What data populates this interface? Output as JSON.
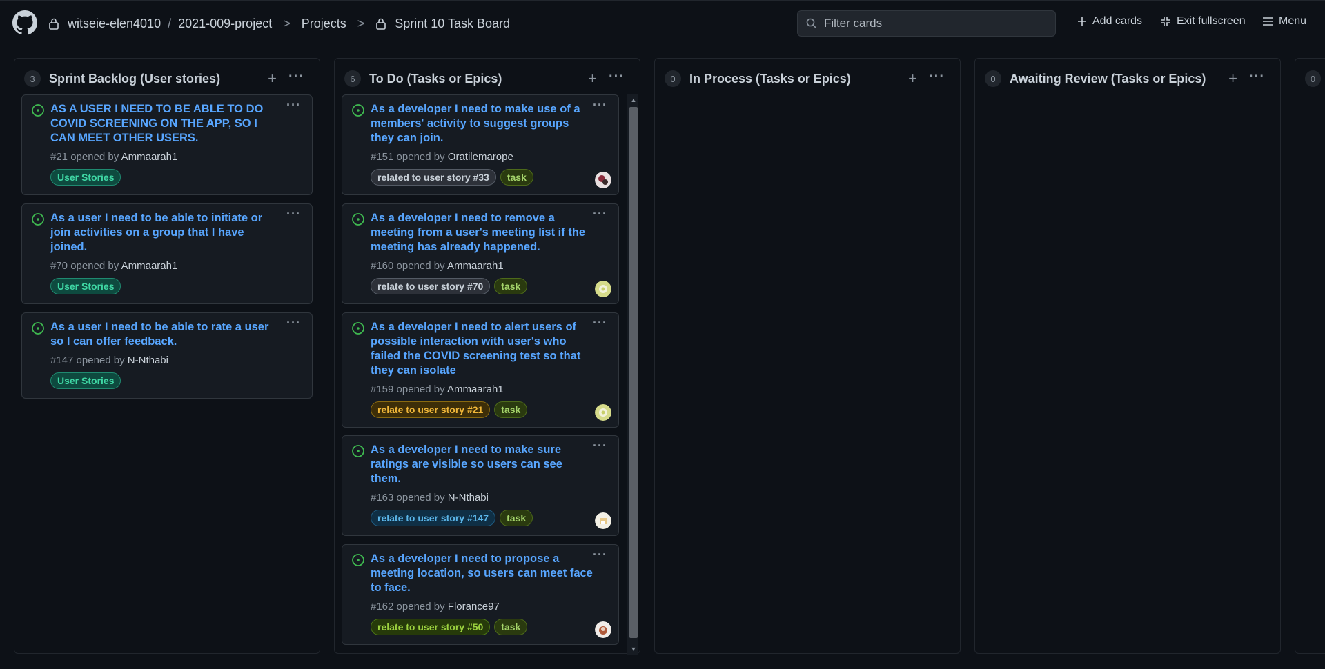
{
  "header": {
    "owner": "witseie-elen4010",
    "separator": "/",
    "repo": "2021-009-project",
    "projects": "Projects",
    "board": "Sprint 10 Task Board",
    "filter_placeholder": "Filter cards",
    "add_cards": "Add cards",
    "exit_fullscreen": "Exit fullscreen",
    "menu": "Menu"
  },
  "columns": [
    {
      "count": "3",
      "title": "Sprint Backlog (User stories)",
      "cards": [
        {
          "title": "AS A USER I NEED TO BE ABLE TO DO COVID SCREENING ON THE APP, SO I CAN MEET OTHER USERS.",
          "meta": "#21 opened by",
          "author": "Ammaarah1",
          "labels": [
            "User Stories"
          ]
        },
        {
          "title": "As a user I need to be able to initiate or join activities on a group that I have joined.",
          "meta": "#70 opened by",
          "author": "Ammaarah1",
          "labels": [
            "User Stories"
          ]
        },
        {
          "title": "As a user I need to be able to rate a user so I can offer feedback.",
          "meta": "#147 opened by",
          "author": "N-Nthabi",
          "labels": [
            "User Stories"
          ]
        }
      ]
    },
    {
      "count": "6",
      "title": "To Do (Tasks or Epics)",
      "cards": [
        {
          "title": "As a developer I need to make use of a members' activity to suggest groups they can join.",
          "meta": "#151 opened by",
          "author": "Oratilemarope",
          "labels": [
            "related to user story #33",
            "task"
          ]
        },
        {
          "title": "As a developer I need to remove a meeting from a user's meeting list if the meeting has already happened.",
          "meta": "#160 opened by",
          "author": "Ammaarah1",
          "labels": [
            "relate to user story #70",
            "task"
          ]
        },
        {
          "title": "As a developer I need to alert users of possible interaction with user's who failed the COVID screening test so that they can isolate",
          "meta": "#159 opened by",
          "author": "Ammaarah1",
          "labels": [
            "relate to user story #21",
            "task"
          ]
        },
        {
          "title": "As a developer I need to make sure ratings are visible so users can see them.",
          "meta": "#163 opened by",
          "author": "N-Nthabi",
          "labels": [
            "relate to user story #147",
            "task"
          ]
        },
        {
          "title": "As a developer I need to propose a meeting location, so users can meet face to face.",
          "meta": "#162 opened by",
          "author": "Florance97",
          "labels": [
            "relate to user story #50",
            "task"
          ]
        }
      ]
    },
    {
      "count": "0",
      "title": "In Process (Tasks or Epics)"
    },
    {
      "count": "0",
      "title": "Awaiting Review (Tasks or Epics)"
    },
    {
      "count": "0"
    }
  ],
  "colors": {
    "background": "#0d1117",
    "link": "#58a6ff",
    "open_issue": "#3fb950"
  }
}
